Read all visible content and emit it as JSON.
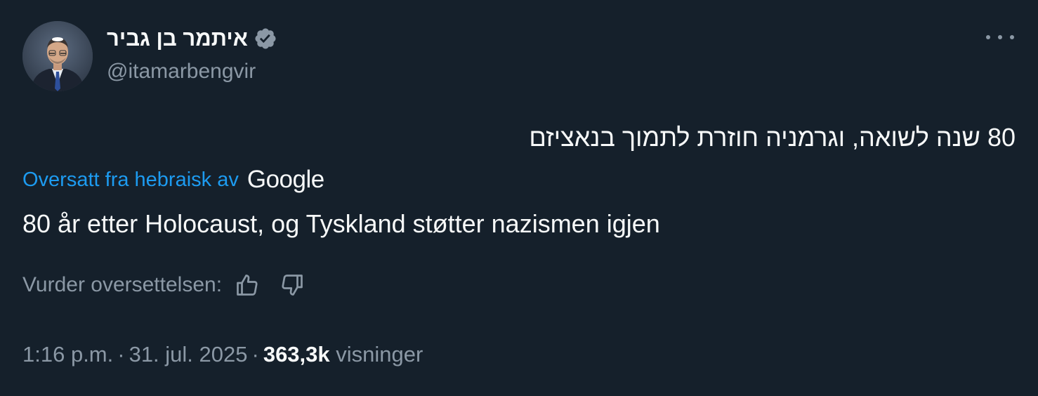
{
  "author": {
    "display_name": "איתמר בן גביר",
    "handle": "@itamarbengvir",
    "verified_icon": "verified-badge-icon"
  },
  "tweet": {
    "original_text": "80 שנה לשואה, וגרמניה חוזרת לתמוך בנאציזם",
    "translated_by_label": "Oversatt fra hebraisk av",
    "translator_brand": "Google",
    "translated_text": "80 år etter Holocaust, og Tyskland støtter nazismen igjen",
    "rate_label": "Vurder oversettelsen:",
    "time": "1:16 p.m.",
    "date": "31. jul. 2025",
    "separator": "·",
    "views_count": "363,3k",
    "views_label": "visninger"
  },
  "colors": {
    "background": "#15202b",
    "text_primary": "#f7f9f9",
    "text_secondary": "#8b98a5",
    "link_blue": "#1d9bf0"
  }
}
